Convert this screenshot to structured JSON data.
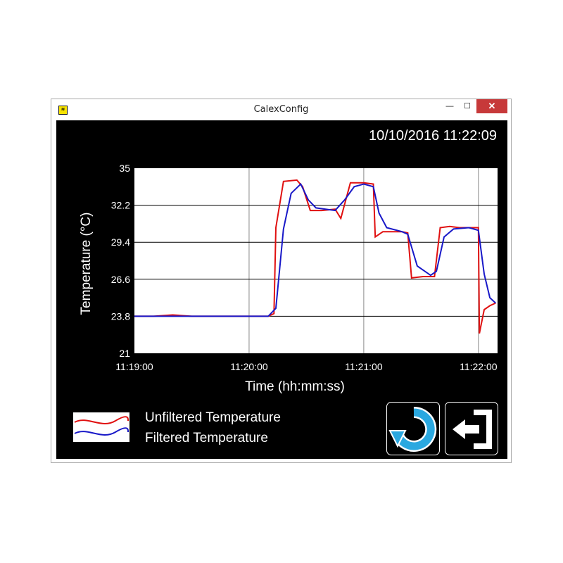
{
  "window": {
    "title": "CalexConfig",
    "minimize_glyph": "—",
    "maximize_glyph": "☐",
    "close_glyph": "✕"
  },
  "datetime": "10/10/2016 11:22:09",
  "chart_data": {
    "type": "line",
    "title": "",
    "xlabel": "Time (hh:mm:ss)",
    "ylabel": "Temperature (°C)",
    "ylim": [
      21,
      35
    ],
    "yticks": [
      "21",
      "23.8",
      "26.6",
      "29.4",
      "32.2",
      "35"
    ],
    "xticks": [
      "11:19:00",
      "11:20:00",
      "11:21:00",
      "11:22:00"
    ],
    "xlim": [
      "11:19:00",
      "11:22:10"
    ],
    "grid": true,
    "legend_position": "bottom-left",
    "series": [
      {
        "name": "Unfiltered Temperature",
        "color": "#e01010",
        "points": [
          [
            "11:19:00",
            23.8
          ],
          [
            "11:19:10",
            23.8
          ],
          [
            "11:19:20",
            23.9
          ],
          [
            "11:19:30",
            23.8
          ],
          [
            "11:19:40",
            23.8
          ],
          [
            "11:19:50",
            23.8
          ],
          [
            "11:20:00",
            23.8
          ],
          [
            "11:20:10",
            23.8
          ],
          [
            "11:20:13",
            24.0
          ],
          [
            "11:20:14",
            30.5
          ],
          [
            "11:20:18",
            34.0
          ],
          [
            "11:20:25",
            34.1
          ],
          [
            "11:20:28",
            33.6
          ],
          [
            "11:20:32",
            31.8
          ],
          [
            "11:20:38",
            31.8
          ],
          [
            "11:20:45",
            31.9
          ],
          [
            "11:20:48",
            31.2
          ],
          [
            "11:20:53",
            33.9
          ],
          [
            "11:21:00",
            33.9
          ],
          [
            "11:21:05",
            33.8
          ],
          [
            "11:21:06",
            29.8
          ],
          [
            "11:21:10",
            30.2
          ],
          [
            "11:21:20",
            30.2
          ],
          [
            "11:21:23",
            30.1
          ],
          [
            "11:21:25",
            26.7
          ],
          [
            "11:21:31",
            26.8
          ],
          [
            "11:21:37",
            26.8
          ],
          [
            "11:21:40",
            30.5
          ],
          [
            "11:21:45",
            30.6
          ],
          [
            "11:21:50",
            30.5
          ],
          [
            "11:21:55",
            30.5
          ],
          [
            "11:22:00",
            30.5
          ],
          [
            "11:22:00.5",
            22.5
          ],
          [
            "11:22:03",
            24.3
          ],
          [
            "11:22:06",
            24.6
          ],
          [
            "11:22:09",
            24.8
          ]
        ]
      },
      {
        "name": "Filtered Temperature",
        "color": "#1818c8",
        "points": [
          [
            "11:19:00",
            23.8
          ],
          [
            "11:19:10",
            23.8
          ],
          [
            "11:19:20",
            23.8
          ],
          [
            "11:19:30",
            23.8
          ],
          [
            "11:19:40",
            23.8
          ],
          [
            "11:19:50",
            23.8
          ],
          [
            "11:20:00",
            23.8
          ],
          [
            "11:20:10",
            23.8
          ],
          [
            "11:20:14",
            24.4
          ],
          [
            "11:20:18",
            30.4
          ],
          [
            "11:20:22",
            33.1
          ],
          [
            "11:20:27",
            33.8
          ],
          [
            "11:20:31",
            32.6
          ],
          [
            "11:20:35",
            32.0
          ],
          [
            "11:20:45",
            31.8
          ],
          [
            "11:20:50",
            32.6
          ],
          [
            "11:20:55",
            33.6
          ],
          [
            "11:21:00",
            33.8
          ],
          [
            "11:21:05",
            33.6
          ],
          [
            "11:21:08",
            31.6
          ],
          [
            "11:21:12",
            30.5
          ],
          [
            "11:21:20",
            30.2
          ],
          [
            "11:21:23",
            30.0
          ],
          [
            "11:21:28",
            27.6
          ],
          [
            "11:21:35",
            26.9
          ],
          [
            "11:21:38",
            27.2
          ],
          [
            "11:21:42",
            29.8
          ],
          [
            "11:21:47",
            30.4
          ],
          [
            "11:21:55",
            30.5
          ],
          [
            "11:22:00",
            30.3
          ],
          [
            "11:22:03",
            27.0
          ],
          [
            "11:22:06",
            25.2
          ],
          [
            "11:22:09",
            24.8
          ]
        ]
      }
    ]
  },
  "legend": {
    "unfiltered_label": "Unfiltered Temperature",
    "filtered_label": "Filtered Temperature"
  },
  "buttons": {
    "refresh_icon": "refresh-icon",
    "exit_icon": "exit-icon"
  }
}
